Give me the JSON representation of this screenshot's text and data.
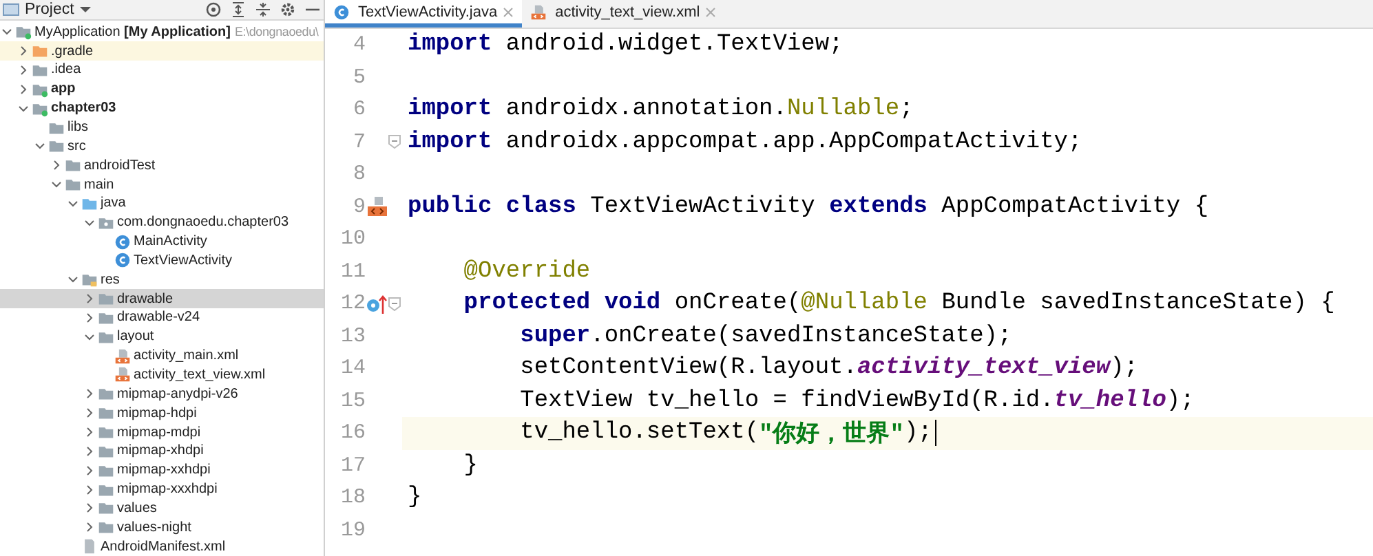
{
  "project_panel": {
    "title": "Project",
    "tree": [
      {
        "label": "MyApplication",
        "tag": "[My Application]",
        "path": "E:\\dongnaoedu\\",
        "kind": "module",
        "expanded": true,
        "selected": false,
        "children": [
          {
            "label": ".gradle",
            "kind": "excluded-folder",
            "expanded": false,
            "selected": false
          },
          {
            "label": ".idea",
            "kind": "folder",
            "expanded": false,
            "selected": false
          },
          {
            "label": "app",
            "kind": "module",
            "bold": true,
            "expanded": false,
            "selected": false
          },
          {
            "label": "chapter03",
            "kind": "module",
            "bold": true,
            "expanded": true,
            "selected": false,
            "children": [
              {
                "label": "libs",
                "kind": "folder",
                "selected": false
              },
              {
                "label": "src",
                "kind": "folder",
                "expanded": true,
                "selected": false,
                "children": [
                  {
                    "label": "androidTest",
                    "kind": "folder",
                    "expanded": false,
                    "selected": false
                  },
                  {
                    "label": "main",
                    "kind": "folder",
                    "expanded": true,
                    "selected": false,
                    "children": [
                      {
                        "label": "java",
                        "kind": "source-folder",
                        "expanded": true,
                        "selected": false,
                        "children": [
                          {
                            "label": "com.dongnaoedu.chapter03",
                            "kind": "package",
                            "expanded": true,
                            "selected": false,
                            "children": [
                              {
                                "label": "MainActivity",
                                "kind": "class",
                                "selected": false
                              },
                              {
                                "label": "TextViewActivity",
                                "kind": "class",
                                "selected": false
                              }
                            ]
                          }
                        ]
                      },
                      {
                        "label": "res",
                        "kind": "res-folder",
                        "expanded": true,
                        "selected": false,
                        "children": [
                          {
                            "label": "drawable",
                            "kind": "folder",
                            "expanded": false,
                            "selected": true
                          },
                          {
                            "label": "drawable-v24",
                            "kind": "folder",
                            "expanded": false,
                            "selected": false
                          },
                          {
                            "label": "layout",
                            "kind": "folder",
                            "expanded": true,
                            "selected": false,
                            "children": [
                              {
                                "label": "activity_main.xml",
                                "kind": "xml",
                                "selected": false
                              },
                              {
                                "label": "activity_text_view.xml",
                                "kind": "xml",
                                "selected": false
                              }
                            ]
                          },
                          {
                            "label": "mipmap-anydpi-v26",
                            "kind": "folder",
                            "expanded": false,
                            "selected": false
                          },
                          {
                            "label": "mipmap-hdpi",
                            "kind": "folder",
                            "expanded": false,
                            "selected": false
                          },
                          {
                            "label": "mipmap-mdpi",
                            "kind": "folder",
                            "expanded": false,
                            "selected": false
                          },
                          {
                            "label": "mipmap-xhdpi",
                            "kind": "folder",
                            "expanded": false,
                            "selected": false
                          },
                          {
                            "label": "mipmap-xxhdpi",
                            "kind": "folder",
                            "expanded": false,
                            "selected": false
                          },
                          {
                            "label": "mipmap-xxxhdpi",
                            "kind": "folder",
                            "expanded": false,
                            "selected": false
                          },
                          {
                            "label": "values",
                            "kind": "folder",
                            "expanded": false,
                            "selected": false
                          },
                          {
                            "label": "values-night",
                            "kind": "folder",
                            "expanded": false,
                            "selected": false
                          }
                        ]
                      },
                      {
                        "label": "AndroidManifest.xml",
                        "kind": "manifest",
                        "selected": false
                      }
                    ]
                  }
                ]
              }
            ]
          }
        ]
      }
    ]
  },
  "editor": {
    "tabs": [
      {
        "label": "TextViewActivity.java",
        "kind": "class",
        "selected": true
      },
      {
        "label": "activity_text_view.xml",
        "kind": "xml",
        "selected": false
      }
    ],
    "lines": [
      {
        "number": "4",
        "current": false,
        "fold": false,
        "tokens": [
          {
            "t": "import",
            "kind": "keyword"
          },
          {
            "t": " android.widget.TextView;",
            "kind": "plain"
          }
        ]
      },
      {
        "number": "5",
        "current": false,
        "fold": false
      },
      {
        "number": "6",
        "current": false,
        "fold": false,
        "tokens": [
          {
            "t": "import",
            "kind": "keyword"
          },
          {
            "t": " androidx.annotation.",
            "kind": "plain"
          },
          {
            "t": "Nullable",
            "kind": "annotation"
          },
          {
            "t": ";",
            "kind": "plain"
          }
        ]
      },
      {
        "number": "7",
        "current": false,
        "fold": true,
        "tokens": [
          {
            "t": "import",
            "kind": "keyword"
          },
          {
            "t": " androidx.appcompat.app.AppCompatActivity;",
            "kind": "plain"
          }
        ]
      },
      {
        "number": "8",
        "current": false,
        "fold": false
      },
      {
        "number": "9",
        "current": false,
        "fold": false,
        "gutter": {
          "kind": "layout"
        },
        "tokens": [
          {
            "t": "public class",
            "kind": "keyword"
          },
          {
            "t": " TextViewActivity ",
            "kind": "plain"
          },
          {
            "t": "extends",
            "kind": "keyword"
          },
          {
            "t": " AppCompatActivity {",
            "kind": "plain"
          }
        ]
      },
      {
        "number": "10",
        "current": false,
        "fold": false
      },
      {
        "number": "11",
        "current": false,
        "fold": false,
        "tokens": [
          {
            "t": "    @Override",
            "kind": "annotation"
          }
        ]
      },
      {
        "number": "12",
        "current": false,
        "fold": true,
        "gutter": {
          "kind": "override"
        },
        "tokens": [
          {
            "t": "    protected void",
            "kind": "keyword"
          },
          {
            "t": " onCreate(",
            "kind": "plain"
          },
          {
            "t": "@Nullable",
            "kind": "annotation"
          },
          {
            "t": " Bundle savedInstanceState) {",
            "kind": "plain"
          }
        ]
      },
      {
        "number": "13",
        "current": false,
        "fold": false,
        "tokens": [
          {
            "t": "        super",
            "kind": "keyword"
          },
          {
            "t": ".onCreate(savedInstanceState);",
            "kind": "plain"
          }
        ]
      },
      {
        "number": "14",
        "current": false,
        "fold": false,
        "tokens": [
          {
            "t": "        setContentView(R.layout.",
            "kind": "plain"
          },
          {
            "t": "activity_text_view",
            "kind": "field"
          },
          {
            "t": ");",
            "kind": "plain"
          }
        ]
      },
      {
        "number": "15",
        "current": false,
        "fold": false,
        "tokens": [
          {
            "t": "        TextView tv_hello = findViewById(R.id.",
            "kind": "plain"
          },
          {
            "t": "tv_hello",
            "kind": "field"
          },
          {
            "t": ");",
            "kind": "plain"
          }
        ]
      },
      {
        "number": "16",
        "current": true,
        "fold": false,
        "tokens": [
          {
            "t": "        tv_hello.setText(",
            "kind": "plain"
          },
          {
            "t": "\"你好，世界\"",
            "kind": "string"
          },
          {
            "t": ");",
            "kind": "plain"
          }
        ]
      },
      {
        "number": "17",
        "current": false,
        "fold": false,
        "tokens": [
          {
            "t": "    }",
            "kind": "plain"
          }
        ]
      },
      {
        "number": "18",
        "current": false,
        "fold": false,
        "tokens": [
          {
            "t": "}",
            "kind": "plain"
          }
        ]
      },
      {
        "number": "19",
        "current": false,
        "fold": false
      }
    ]
  }
}
